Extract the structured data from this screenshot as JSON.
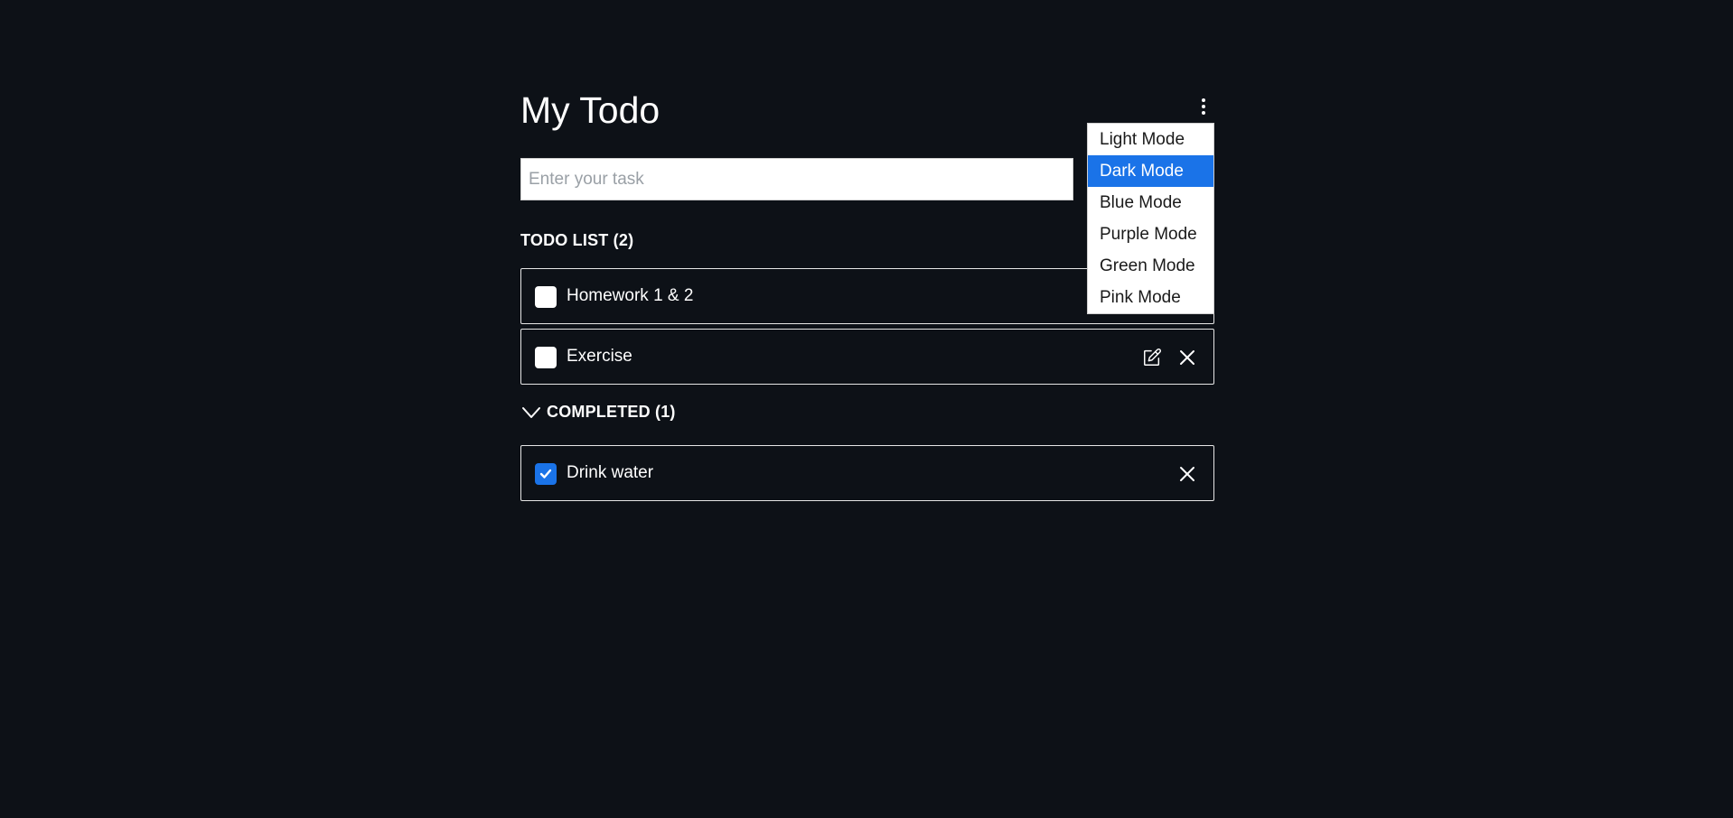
{
  "app": {
    "title": "My Todo"
  },
  "menu": {
    "icon": "more-vertical-icon",
    "options": [
      "Light Mode",
      "Dark Mode",
      "Blue Mode",
      "Purple Mode",
      "Green Mode",
      "Pink Mode"
    ],
    "selected": "Dark Mode"
  },
  "input": {
    "placeholder": "Enter your task",
    "value": ""
  },
  "todo": {
    "heading": "TODO LIST (2)",
    "items": [
      {
        "label": "Homework 1 & 2",
        "checked": false
      },
      {
        "label": "Exercise",
        "checked": false
      }
    ]
  },
  "completed": {
    "heading": "COMPLETED (1)",
    "expanded": true,
    "items": [
      {
        "label": "Drink water",
        "checked": true
      }
    ]
  },
  "colors": {
    "background": "#0d1117",
    "accent": "#1a73e8",
    "text": "#ffffff",
    "border": "#e6e6e6"
  }
}
